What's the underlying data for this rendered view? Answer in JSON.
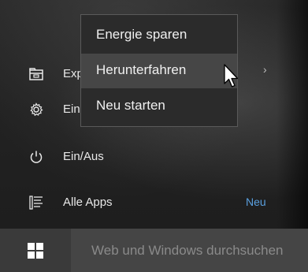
{
  "start_menu": {
    "items": [
      {
        "label": "Explorer",
        "icon": "file-explorer-icon"
      },
      {
        "label": "Einstellungen",
        "icon": "gear-icon"
      },
      {
        "label": "Ein/Aus",
        "icon": "power-icon"
      },
      {
        "label": "Alle Apps",
        "icon": "all-apps-icon"
      }
    ],
    "all_apps_badge": "Neu",
    "chevron": "›"
  },
  "power_flyout": {
    "options": [
      "Energie sparen",
      "Herunterfahren",
      "Neu starten"
    ],
    "hovered": "Herunterfahren"
  },
  "taskbar": {
    "start_icon": "windows-logo-icon",
    "search_placeholder": "Web und Windows durchsuchen"
  },
  "colors": {
    "accent": "#5aa0e0",
    "taskbar": "#3a3a3a",
    "flyout_bg": "#2b2b2b",
    "flyout_hover": "#464646"
  }
}
